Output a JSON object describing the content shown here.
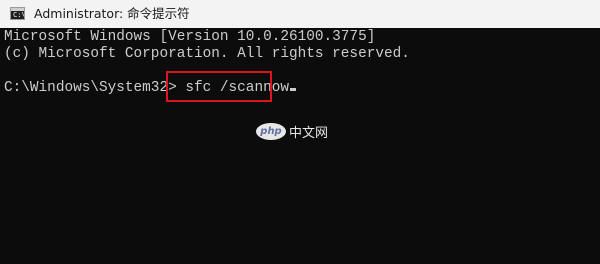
{
  "window": {
    "title": "Administrator: 命令提示符",
    "icon": "cmd-prompt-icon",
    "icon_glyph": "C:\\"
  },
  "console": {
    "lines": [
      "Microsoft Windows [Version 10.0.26100.3775]",
      "(c) Microsoft Corporation. All rights reserved."
    ],
    "prompt": "C:\\Windows\\System32>",
    "command": "sfc /scannow"
  },
  "highlight": {
    "color": "#e0141e"
  },
  "watermark": {
    "logo_text": "php",
    "text": "中文网"
  },
  "colors": {
    "background": "#0c0c0c",
    "text": "#cccccc",
    "titlebar": "#f3f3f3"
  }
}
